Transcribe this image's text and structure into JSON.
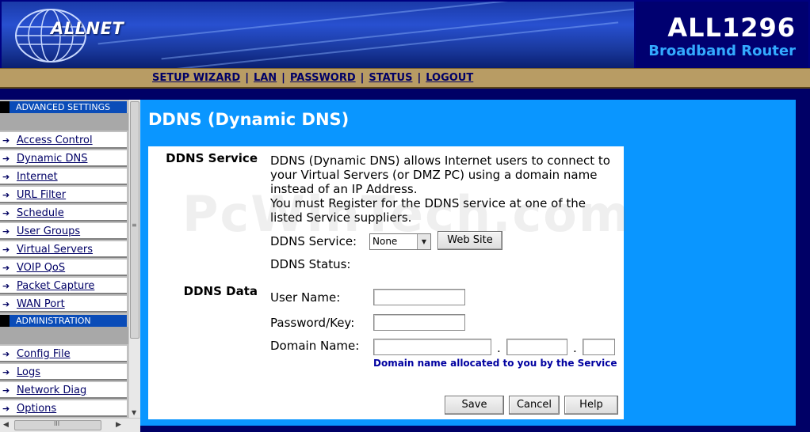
{
  "header": {
    "brand": "ALLNET",
    "model": "ALL1296",
    "subtitle": "Broadband Router"
  },
  "topnav": {
    "links": [
      "SETUP WIZARD",
      "LAN",
      "PASSWORD",
      "STATUS",
      "LOGOUT"
    ],
    "separator": "|"
  },
  "sidebar": {
    "advanced_heading": "ADVANCED SETTINGS",
    "advanced_items": [
      "Access Control",
      "Dynamic DNS",
      "Internet",
      "URL Filter",
      "Schedule",
      "User Groups",
      "Virtual Servers",
      "VOIP QoS",
      "Packet Capture",
      "WAN Port"
    ],
    "admin_heading": "ADMINISTRATION",
    "admin_items": [
      "Config File",
      "Logs",
      "Network Diag",
      "Options"
    ],
    "arrow_glyph": "➔"
  },
  "main": {
    "title": "DDNS (Dynamic DNS)",
    "ddns_service_label": "DDNS Service",
    "description": "DDNS (Dynamic DNS) allows Internet users to connect to your Virtual Servers (or DMZ PC) using a domain name instead of an IP Address.\nYou must Register for the DDNS service at one of the listed Service suppliers.",
    "service_field_label": "DDNS Service:",
    "service_selected": "None",
    "web_site_button": "Web Site",
    "status_label": "DDNS Status:",
    "ddns_data_label": "DDNS Data",
    "username_label": "User Name:",
    "username_value": "",
    "password_label": "Password/Key:",
    "password_value": "",
    "domain_label": "Domain Name:",
    "domain_part1": "",
    "domain_part2": "",
    "domain_part3": "",
    "domain_dot": ".",
    "domain_hint": "Domain name allocated to you by the Service",
    "buttons": {
      "save": "Save",
      "cancel": "Cancel",
      "help": "Help"
    }
  },
  "watermark": "PcWinTech.com",
  "colors": {
    "page_bg": "#000066",
    "main_panel": "#0a96ff",
    "nav_bar": "#b89c64",
    "sidebar_heading": "#0a4cb8",
    "hint_text": "#0000a0",
    "subtitle": "#33aaff"
  }
}
